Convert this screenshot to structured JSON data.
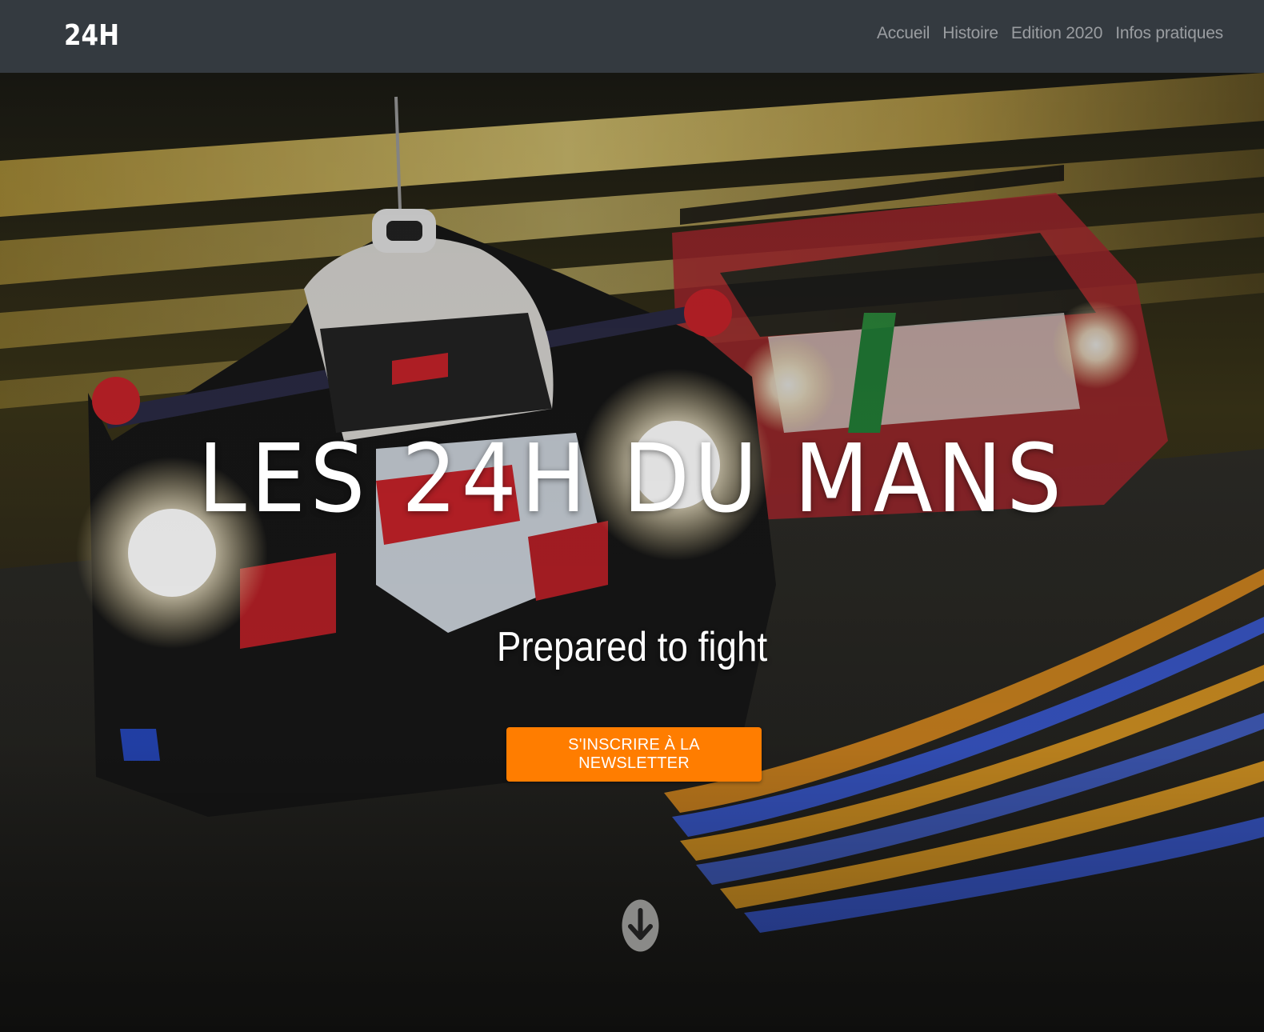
{
  "navbar": {
    "brand": "24H",
    "links": [
      "Accueil",
      "Histoire",
      "Edition 2020",
      "Infos pratiques"
    ]
  },
  "hero": {
    "title": "LES 24H DU MANS",
    "subtitle": "Prepared to fight",
    "button_label": "S'INSCRIRE À LA NEWSLETTER",
    "scroll_icon": "arrow-down-circle-icon"
  },
  "colors": {
    "navbar_bg": "#343a40",
    "nav_link": "#9a9da1",
    "brand": "#ffffff",
    "cta_bg": "#ff7d00",
    "cta_text": "#ffffff"
  }
}
